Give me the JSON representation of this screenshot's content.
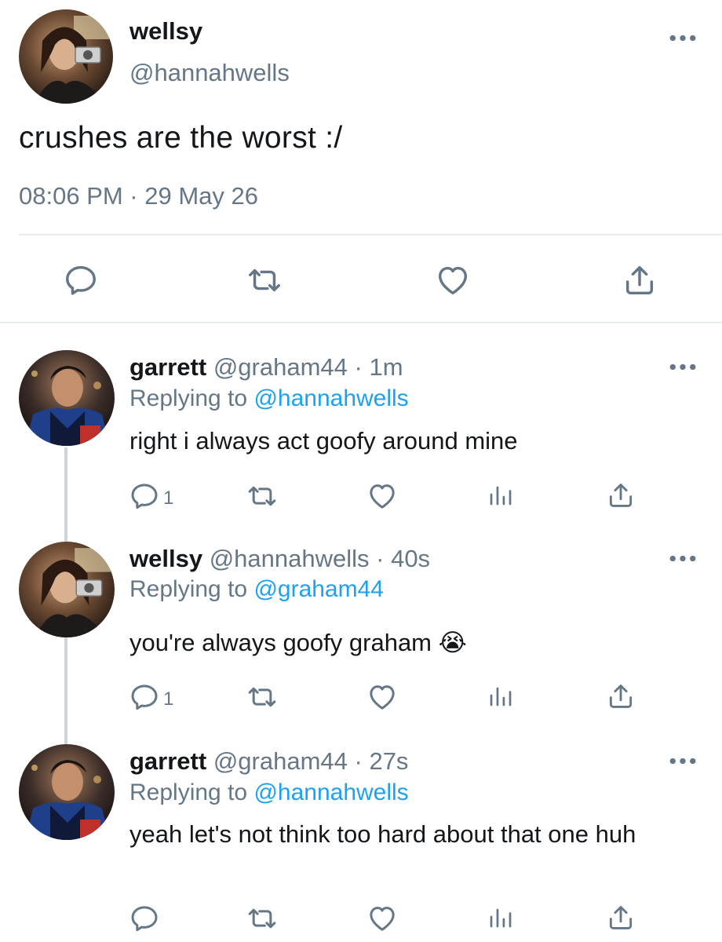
{
  "main_tweet": {
    "display_name": "wellsy",
    "handle": "@hannahwells",
    "text": "crushes are the worst :/",
    "timestamp": "08:06 PM · 29 May 26",
    "more_label": "•••"
  },
  "replies": [
    {
      "display_name": "garrett",
      "handle": "@graham44",
      "time": "· 1m",
      "replying_prefix": "Replying to",
      "replying_to": "@hannahwells",
      "text": "right i always act goofy around mine",
      "reply_count": "1",
      "more_label": "•••"
    },
    {
      "display_name": "wellsy",
      "handle": "@hannahwells",
      "time": "· 40s",
      "replying_prefix": "Replying to",
      "replying_to": "@graham44",
      "text": "you're always goofy graham 😭",
      "reply_count": "1",
      "more_label": "•••"
    },
    {
      "display_name": "garrett",
      "handle": "@graham44",
      "time": "· 27s",
      "replying_prefix": "Replying to",
      "replying_to": "@hannahwells",
      "text": "yeah let's not think too hard about that one huh",
      "reply_count": "",
      "more_label": "•••"
    }
  ],
  "colors": {
    "accent": "#1da1f2",
    "muted": "#657786",
    "icon": "#657786",
    "divider": "#e6ecf0"
  }
}
